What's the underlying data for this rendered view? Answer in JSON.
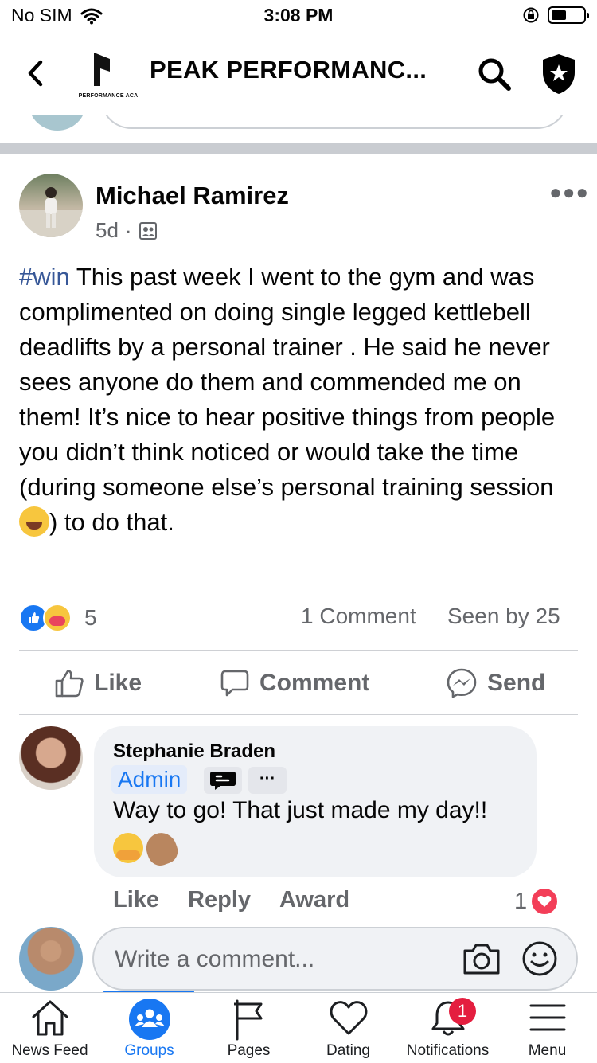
{
  "status_bar": {
    "carrier": "No SIM",
    "time": "3:08 PM"
  },
  "header": {
    "logo_text": "PERFORMANCE ACA",
    "title": "PEAK PERFORMANC..."
  },
  "post": {
    "author": "Michael Ramirez",
    "time": "5d",
    "meta_separator": "·",
    "hashtag": "#win",
    "body_line_1": " This past week I went to the gym and was complimented on doing single legged kettlebell deadlifts by a personal trainer . He said he never sees anyone do them and commended me on them! It’s nice to hear positive things from people you didn’t think noticed or would take the time (during someone else’s personal training session ",
    "body_line_2": ") to do that.",
    "reaction_count": "5",
    "comment_count": "1 Comment",
    "seen_by": "Seen by 25",
    "actions": {
      "like": "Like",
      "comment": "Comment",
      "send": "Send"
    }
  },
  "comment": {
    "author": "Stephanie Braden",
    "badge": "Admin",
    "more": "···",
    "text": "Way to go! That just made my day!!",
    "actions": {
      "like": "Like",
      "reply": "Reply",
      "award": "Award"
    },
    "reaction_count": "1"
  },
  "composer": {
    "placeholder": "Write a comment..."
  },
  "tabbar": {
    "tabs": [
      {
        "label": "News Feed"
      },
      {
        "label": "Groups"
      },
      {
        "label": "Pages"
      },
      {
        "label": "Dating"
      },
      {
        "label": "Notifications"
      },
      {
        "label": "Menu"
      }
    ],
    "notifications_badge": "1"
  },
  "colors": {
    "accent": "#1877f2",
    "hashtag": "#385898",
    "secondary_text": "#65676b",
    "notification_badge": "#e41e3f"
  }
}
